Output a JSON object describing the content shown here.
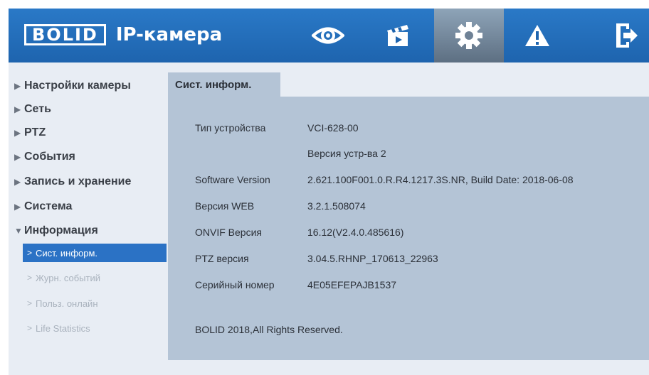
{
  "header": {
    "logo_badge": "BOLID",
    "logo_text": "IP-камера",
    "nav": [
      {
        "icon": "eye-icon",
        "label": "live-view"
      },
      {
        "icon": "clapperboard-icon",
        "label": "playback"
      },
      {
        "icon": "gear-icon",
        "label": "settings"
      },
      {
        "icon": "warning-icon",
        "label": "alarm"
      },
      {
        "icon": "logout-icon",
        "label": "logout"
      }
    ],
    "colors": {
      "bar": "#2a79c7",
      "active": "#6f8296"
    }
  },
  "sidebar": {
    "items": [
      {
        "label": "Настройки камеры",
        "expanded": false
      },
      {
        "label": "Сеть",
        "expanded": false
      },
      {
        "label": "PTZ",
        "expanded": false
      },
      {
        "label": "События",
        "expanded": false
      },
      {
        "label": "Запись и хранение",
        "expanded": false
      },
      {
        "label": "Система",
        "expanded": false
      },
      {
        "label": "Информация",
        "expanded": true
      }
    ],
    "sub_items": [
      {
        "label": "Сист. информ.",
        "active": true
      },
      {
        "label": "Журн. событий",
        "active": false
      },
      {
        "label": "Польз. онлайн",
        "active": false
      },
      {
        "label": "Life Statistics",
        "active": false
      }
    ]
  },
  "main": {
    "tab": "Сист. информ.",
    "rows": [
      {
        "label": "Тип устройства",
        "value": "VCI-628-00"
      },
      {
        "label": "",
        "value": "Версия устр-ва 2"
      },
      {
        "label": "Software Version",
        "value": "2.621.100F001.0.R.R4.1217.3S.NR, Build Date: 2018-06-08"
      },
      {
        "label": "Версия WEB",
        "value": "3.2.1.508074"
      },
      {
        "label": "ONVIF Версия",
        "value": "16.12(V2.4.0.485616)"
      },
      {
        "label": "PTZ версия",
        "value": "3.04.5.RHNP_170613_22963"
      },
      {
        "label": "Серийный номер",
        "value": "4E05EFEPAJB1537"
      }
    ],
    "footer": "BOLID 2018,All Rights Reserved."
  }
}
